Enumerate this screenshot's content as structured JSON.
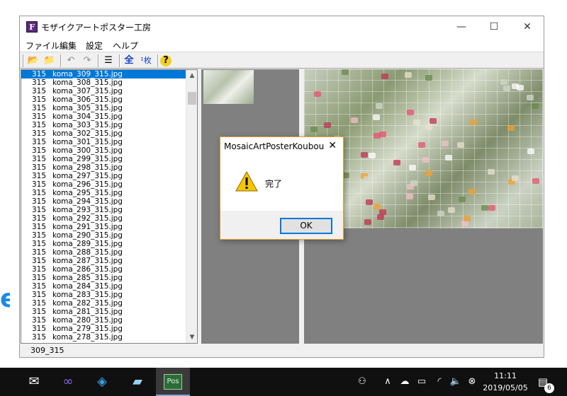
{
  "window": {
    "title": "モザイクアートポスター工房",
    "app_icon_glyph": "F",
    "minimize_glyph": "—",
    "maximize_glyph": "☐",
    "close_glyph": "✕"
  },
  "menu": [
    {
      "label": "ファイル"
    },
    {
      "label": "編集"
    },
    {
      "label": "設定"
    },
    {
      "label": "ヘルプ"
    }
  ],
  "toolbar": {
    "buttons": [
      {
        "name": "open-folder-icon",
        "glyph": "📂"
      },
      {
        "name": "new-folder-icon",
        "glyph": "📁"
      },
      {
        "name": "undo-icon",
        "glyph": "↶"
      },
      {
        "name": "redo-icon",
        "glyph": "↷"
      },
      {
        "name": "list-icon",
        "glyph": "☰"
      },
      {
        "name": "select-all-icon",
        "glyph": "全"
      },
      {
        "name": "one-sheet-icon",
        "glyph": "¹枚"
      },
      {
        "name": "help-icon",
        "glyph": "?"
      }
    ]
  },
  "list": {
    "items": [
      {
        "num": "315",
        "name": "koma_309_315.jpg"
      },
      {
        "num": "315",
        "name": "koma_308_315.jpg"
      },
      {
        "num": "315",
        "name": "koma_307_315.jpg"
      },
      {
        "num": "315",
        "name": "koma_306_315.jpg"
      },
      {
        "num": "315",
        "name": "koma_305_315.jpg"
      },
      {
        "num": "315",
        "name": "koma_304_315.jpg"
      },
      {
        "num": "315",
        "name": "koma_303_315.jpg"
      },
      {
        "num": "315",
        "name": "koma_302_315.jpg"
      },
      {
        "num": "315",
        "name": "koma_301_315.jpg"
      },
      {
        "num": "315",
        "name": "koma_300_315.jpg"
      },
      {
        "num": "315",
        "name": "koma_299_315.jpg"
      },
      {
        "num": "315",
        "name": "koma_298_315.jpg"
      },
      {
        "num": "315",
        "name": "koma_297_315.jpg"
      },
      {
        "num": "315",
        "name": "koma_296_315.jpg"
      },
      {
        "num": "315",
        "name": "koma_295_315.jpg"
      },
      {
        "num": "315",
        "name": "koma_294_315.jpg"
      },
      {
        "num": "315",
        "name": "koma_293_315.jpg"
      },
      {
        "num": "315",
        "name": "koma_292_315.jpg"
      },
      {
        "num": "315",
        "name": "koma_291_315.jpg"
      },
      {
        "num": "315",
        "name": "koma_290_315.jpg"
      },
      {
        "num": "315",
        "name": "koma_289_315.jpg"
      },
      {
        "num": "315",
        "name": "koma_288_315.jpg"
      },
      {
        "num": "315",
        "name": "koma_287_315.jpg"
      },
      {
        "num": "315",
        "name": "koma_286_315.jpg"
      },
      {
        "num": "315",
        "name": "koma_285_315.jpg"
      },
      {
        "num": "315",
        "name": "koma_284_315.jpg"
      },
      {
        "num": "315",
        "name": "koma_283_315.jpg"
      },
      {
        "num": "315",
        "name": "koma_282_315.jpg"
      },
      {
        "num": "315",
        "name": "koma_281_315.jpg"
      },
      {
        "num": "315",
        "name": "koma_280_315.jpg"
      },
      {
        "num": "315",
        "name": "koma_279_315.jpg"
      },
      {
        "num": "315",
        "name": "koma_278_315.jpg"
      }
    ],
    "selected_index": 0
  },
  "status": {
    "text": "309_315"
  },
  "dialog": {
    "title": "MosaicArtPosterKoubou",
    "close_glyph": "✕",
    "message": "完了",
    "ok_label": "OK"
  },
  "taskbar": {
    "time": "11:11",
    "date": "2019/05/05",
    "notification_count": "6",
    "active_app_label": "Pos"
  },
  "colors": {
    "selection": "#0078d7",
    "dialog_border": "#e0a030",
    "pane_gray": "#808080",
    "taskbar": "#101010"
  }
}
